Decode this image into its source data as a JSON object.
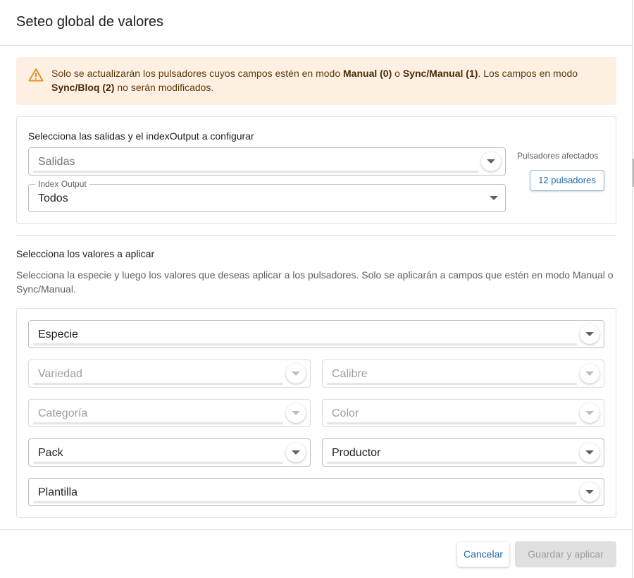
{
  "dialog": {
    "title": "Seteo global de valores"
  },
  "alert": {
    "icon": "warning-icon",
    "color": "#e8901e",
    "background": "#fdf0e3",
    "text_1": "Solo se actualizarán los pulsadores cuyos campos estén en modo ",
    "bold_1": "Manual (0)",
    "text_2": " o ",
    "bold_2": "Sync/Manual (1)",
    "text_3": ". Los campos en modo ",
    "bold_3": "Sync/Bloq (2)",
    "text_4": " no serán modificados."
  },
  "outputs": {
    "label": "Selecciona las salidas y el indexOutput a configurar",
    "salidas_placeholder": "Salidas",
    "index_output_label": "Index Output",
    "index_output_value": "Todos",
    "affected_label": "Pulsadores afectados",
    "affected_button": "12 pulsadores"
  },
  "values": {
    "title": "Selecciona los valores a aplicar",
    "description": "Selecciona la especie y luego los valores que deseas aplicar a los pulsadores. Solo se aplicarán a campos que estén en modo Manual o Sync/Manual.",
    "especie": "Especie",
    "variedad": "Variedad",
    "calibre": "Calibre",
    "categoria": "Categoría",
    "color": "Color",
    "pack": "Pack",
    "productor": "Productor",
    "plantilla": "Plantilla"
  },
  "footer": {
    "cancel": "Cancelar",
    "save": "Guardar y aplicar"
  },
  "colors": {
    "accent": "#1e6aa6",
    "disabled_button": "#e0e0e0"
  }
}
